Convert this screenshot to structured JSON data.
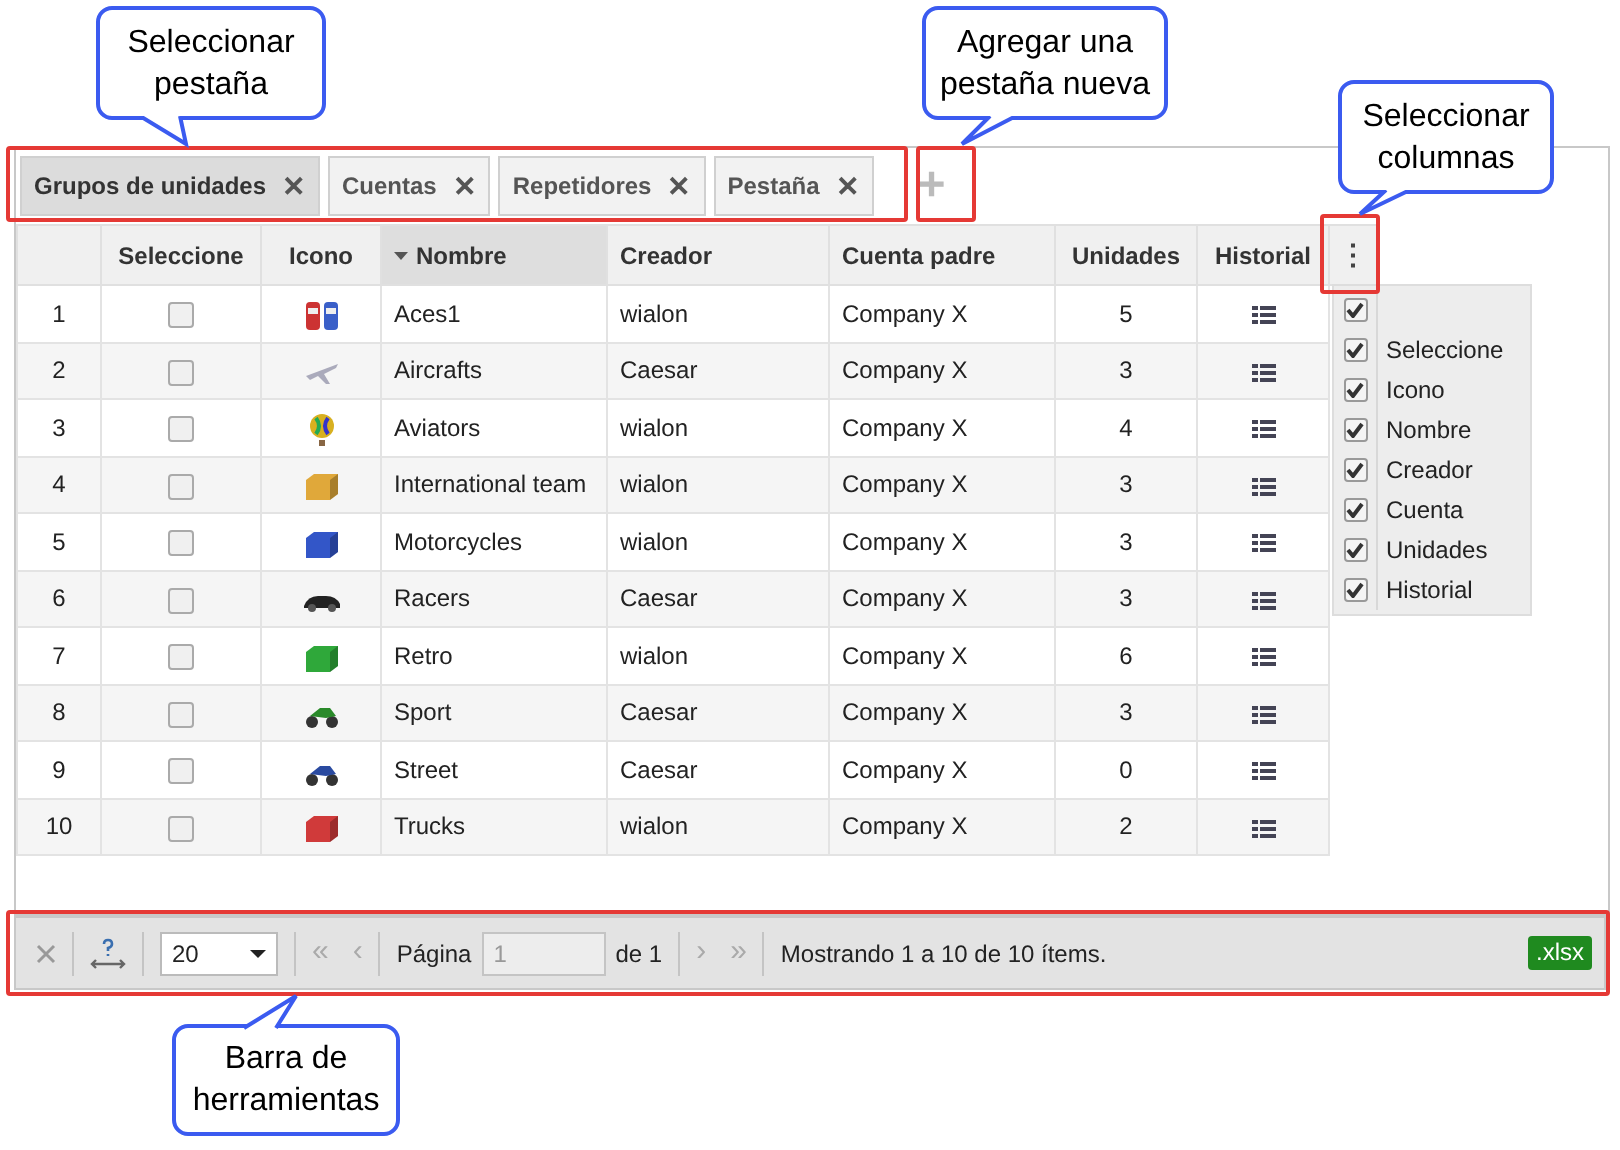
{
  "tabs": [
    {
      "label": "Grupos de unidades",
      "close": "✕",
      "selected": true
    },
    {
      "label": "Cuentas",
      "close": "✕",
      "selected": false
    },
    {
      "label": "Repetidores",
      "close": "✕",
      "selected": false
    },
    {
      "label": "Pestaña",
      "close": "✕",
      "selected": false
    }
  ],
  "add_tab": "+",
  "table": {
    "columns": [
      {
        "sorted": false
      },
      {
        "label": "Seleccione",
        "sorted": false
      },
      {
        "label": "Icono",
        "sorted": false
      },
      {
        "label": "Nombre",
        "sorted": true
      },
      {
        "label": "Creador",
        "sorted": false
      },
      {
        "label": "Cuenta padre",
        "sorted": false
      },
      {
        "label": "Unidades",
        "sorted": false
      },
      {
        "label": "Historial",
        "sorted": false
      }
    ],
    "column_menu_button": "⋮",
    "rows": [
      {
        "number": "1",
        "checked": false,
        "icon": {
          "kind": "cars"
        },
        "name": "Aces1",
        "creator": "wialon",
        "account": "Company X",
        "units": "5"
      },
      {
        "number": "2",
        "checked": false,
        "icon": {
          "kind": "plane"
        },
        "name": "Aircrafts",
        "creator": "Caesar",
        "account": "Company X",
        "units": "3"
      },
      {
        "number": "3",
        "checked": false,
        "icon": {
          "kind": "balloon"
        },
        "name": "Aviators",
        "creator": "wialon",
        "account": "Company X",
        "units": "4"
      },
      {
        "number": "4",
        "checked": false,
        "icon": {
          "kind": "container",
          "color": "#e0a83a"
        },
        "name": "International team",
        "creator": "wialon",
        "account": "Company X",
        "units": "3"
      },
      {
        "number": "5",
        "checked": false,
        "icon": {
          "kind": "container",
          "color": "#3356c8"
        },
        "name": "Motorcycles",
        "creator": "wialon",
        "account": "Company X",
        "units": "3"
      },
      {
        "number": "6",
        "checked": false,
        "icon": {
          "kind": "racer"
        },
        "name": "Racers",
        "creator": "Caesar",
        "account": "Company X",
        "units": "3"
      },
      {
        "number": "7",
        "checked": false,
        "icon": {
          "kind": "container",
          "color": "#2fa83a"
        },
        "name": "Retro",
        "creator": "wialon",
        "account": "Company X",
        "units": "6"
      },
      {
        "number": "8",
        "checked": false,
        "icon": {
          "kind": "moto",
          "color": "#2a8a2a"
        },
        "name": "Sport",
        "creator": "Caesar",
        "account": "Company X",
        "units": "3"
      },
      {
        "number": "9",
        "checked": false,
        "icon": {
          "kind": "moto",
          "color": "#2a4aa0"
        },
        "name": "Street",
        "creator": "Caesar",
        "account": "Company X",
        "units": "0"
      },
      {
        "number": "10",
        "checked": false,
        "icon": {
          "kind": "container",
          "color": "#d03a3a"
        },
        "name": "Trucks",
        "creator": "wialon",
        "account": "Company X",
        "units": "2"
      }
    ]
  },
  "column_menu": [
    {
      "checked": true
    },
    {
      "label": "Seleccione",
      "checked": true
    },
    {
      "label": "Icono",
      "checked": true
    },
    {
      "label": "Nombre",
      "checked": true
    },
    {
      "label": "Creador",
      "checked": true
    },
    {
      "label": "Cuenta",
      "checked": true
    },
    {
      "label": "Unidades",
      "checked": true
    },
    {
      "label": "Historial",
      "checked": true
    }
  ],
  "toolbar": {
    "page_size": "20",
    "first": "«",
    "prev": "‹",
    "page_label": "Página",
    "page_value": "1",
    "page_total": "de 1",
    "next": "›",
    "last": "»",
    "status": "Mostrando 1 a 10 de 10 ítems.",
    "export": ".xlsx"
  },
  "callouts": [
    {
      "text": "Seleccionar pestaña"
    },
    {
      "text": "Agregar una pestaña nueva"
    },
    {
      "text": "Seleccionar columnas"
    },
    {
      "text": "Barra de herramientas"
    }
  ]
}
